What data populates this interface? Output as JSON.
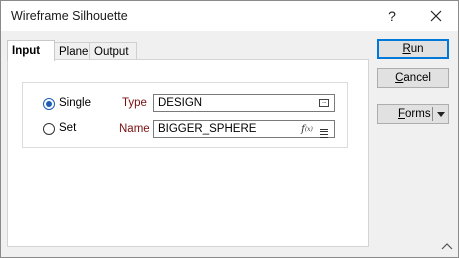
{
  "window": {
    "title": "Wireframe Silhouette",
    "help_label": "?",
    "close_label": "✕"
  },
  "tabs": [
    {
      "label": "Input",
      "active": true
    },
    {
      "label": "Plane",
      "active": false
    },
    {
      "label": "Output",
      "active": false
    }
  ],
  "input": {
    "mode_options": [
      {
        "label": "Single",
        "selected": true
      },
      {
        "label": "Set",
        "selected": false
      }
    ],
    "type": {
      "label": "Type",
      "value": "DESIGN",
      "icon": "ellipsis-browse-icon"
    },
    "name": {
      "label": "Name",
      "value": "BIGGER_SPHERE",
      "icons": [
        "function-icon",
        "list-icon"
      ]
    }
  },
  "buttons": {
    "run": "Run",
    "cancel": "Cancel",
    "forms": "Forms"
  },
  "colors": {
    "accent": "#0078d7",
    "field_label": "#7a1010",
    "radio_selected": "#1a5fb4"
  }
}
